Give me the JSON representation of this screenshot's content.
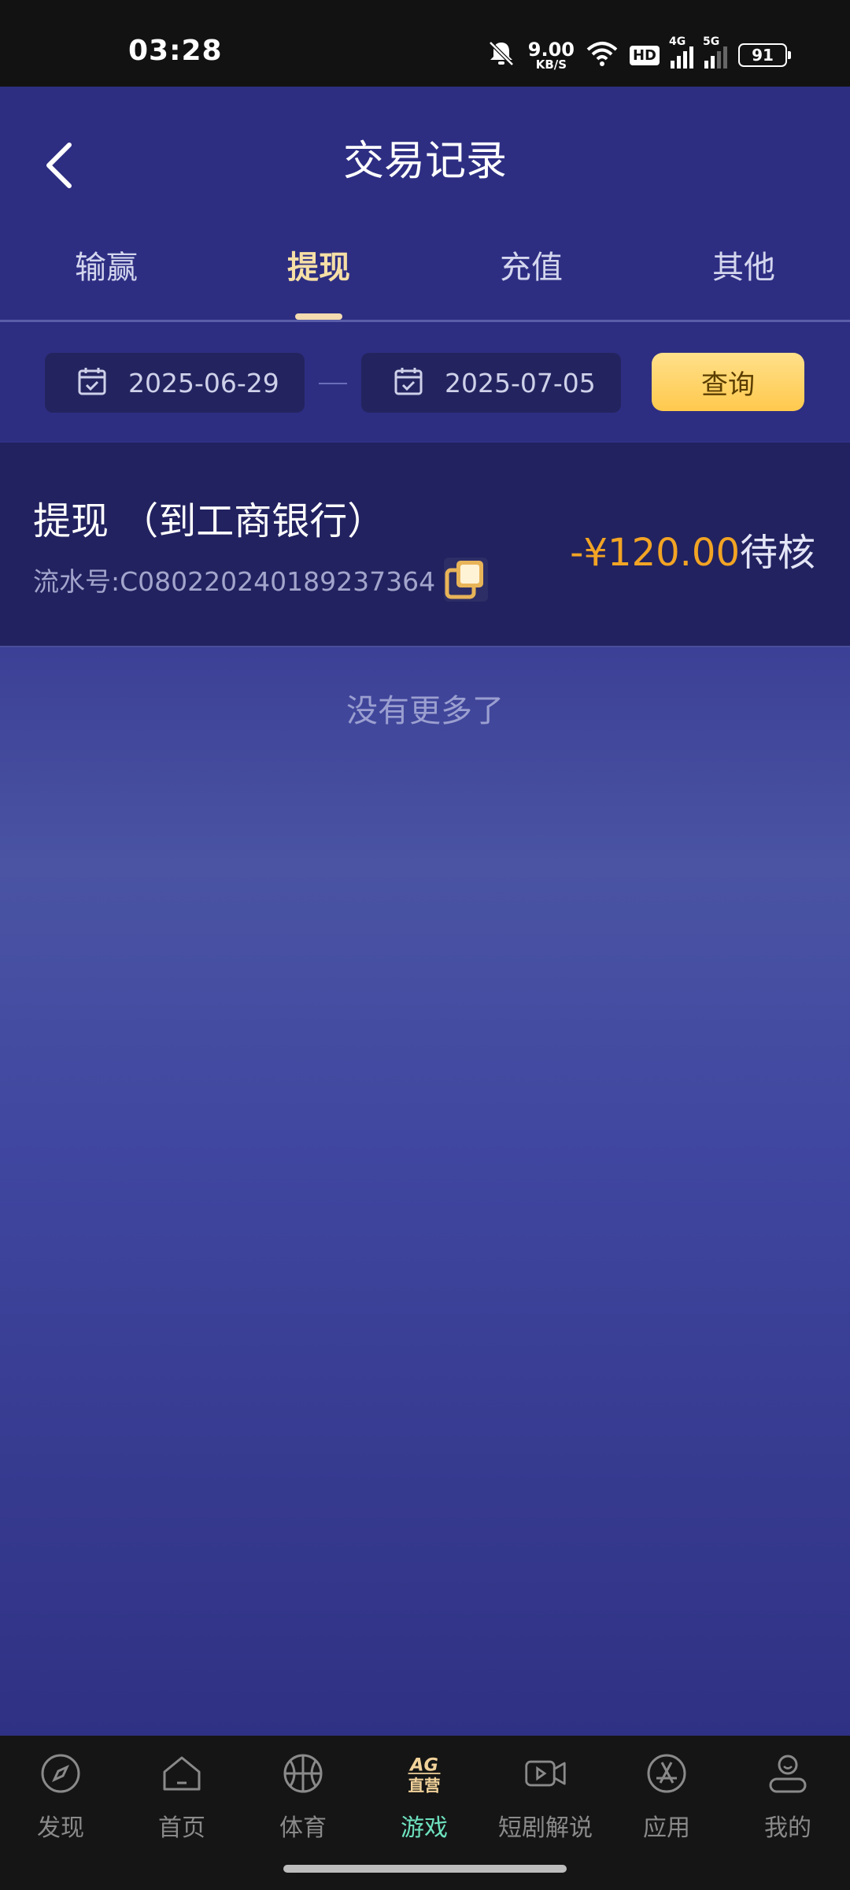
{
  "status_bar": {
    "time": "03:28",
    "net_speed_value": "9.00",
    "net_speed_unit": "KB/S",
    "hd_label": "HD",
    "sim1_label": "4G",
    "sim2_label": "5G",
    "battery": "91"
  },
  "header": {
    "title": "交易记录",
    "tabs": [
      {
        "label": "输赢",
        "active": false
      },
      {
        "label": "提现",
        "active": true
      },
      {
        "label": "充值",
        "active": false
      },
      {
        "label": "其他",
        "active": false
      }
    ]
  },
  "filter": {
    "start_date": "2025-06-29",
    "end_date": "2025-07-05",
    "query_label": "查询"
  },
  "records": [
    {
      "title": "提现 （到工商银行）",
      "serial": "流水号:C080220240189237364",
      "amount": "-¥120.00",
      "status": "待核"
    }
  ],
  "list_footer": "没有更多了",
  "bottom_nav": [
    {
      "label": "发现",
      "icon": "compass-icon",
      "active": false
    },
    {
      "label": "首页",
      "icon": "home-icon",
      "active": false
    },
    {
      "label": "体育",
      "icon": "basketball-icon",
      "active": false
    },
    {
      "label": "游戏",
      "icon": "ag-direct-icon",
      "active": true,
      "icon_text_top": "AG",
      "icon_text_bottom": "直营"
    },
    {
      "label": "短剧解说",
      "icon": "video-icon",
      "active": false
    },
    {
      "label": "应用",
      "icon": "app-store-icon",
      "active": false
    },
    {
      "label": "我的",
      "icon": "user-icon",
      "active": false
    }
  ],
  "colors": {
    "header_bg": "#2d2e82",
    "active_tab": "#f6dfa6",
    "amount": "#f2a424",
    "query_button": "#ffd66b",
    "nav_active": "#6ee2bf"
  }
}
